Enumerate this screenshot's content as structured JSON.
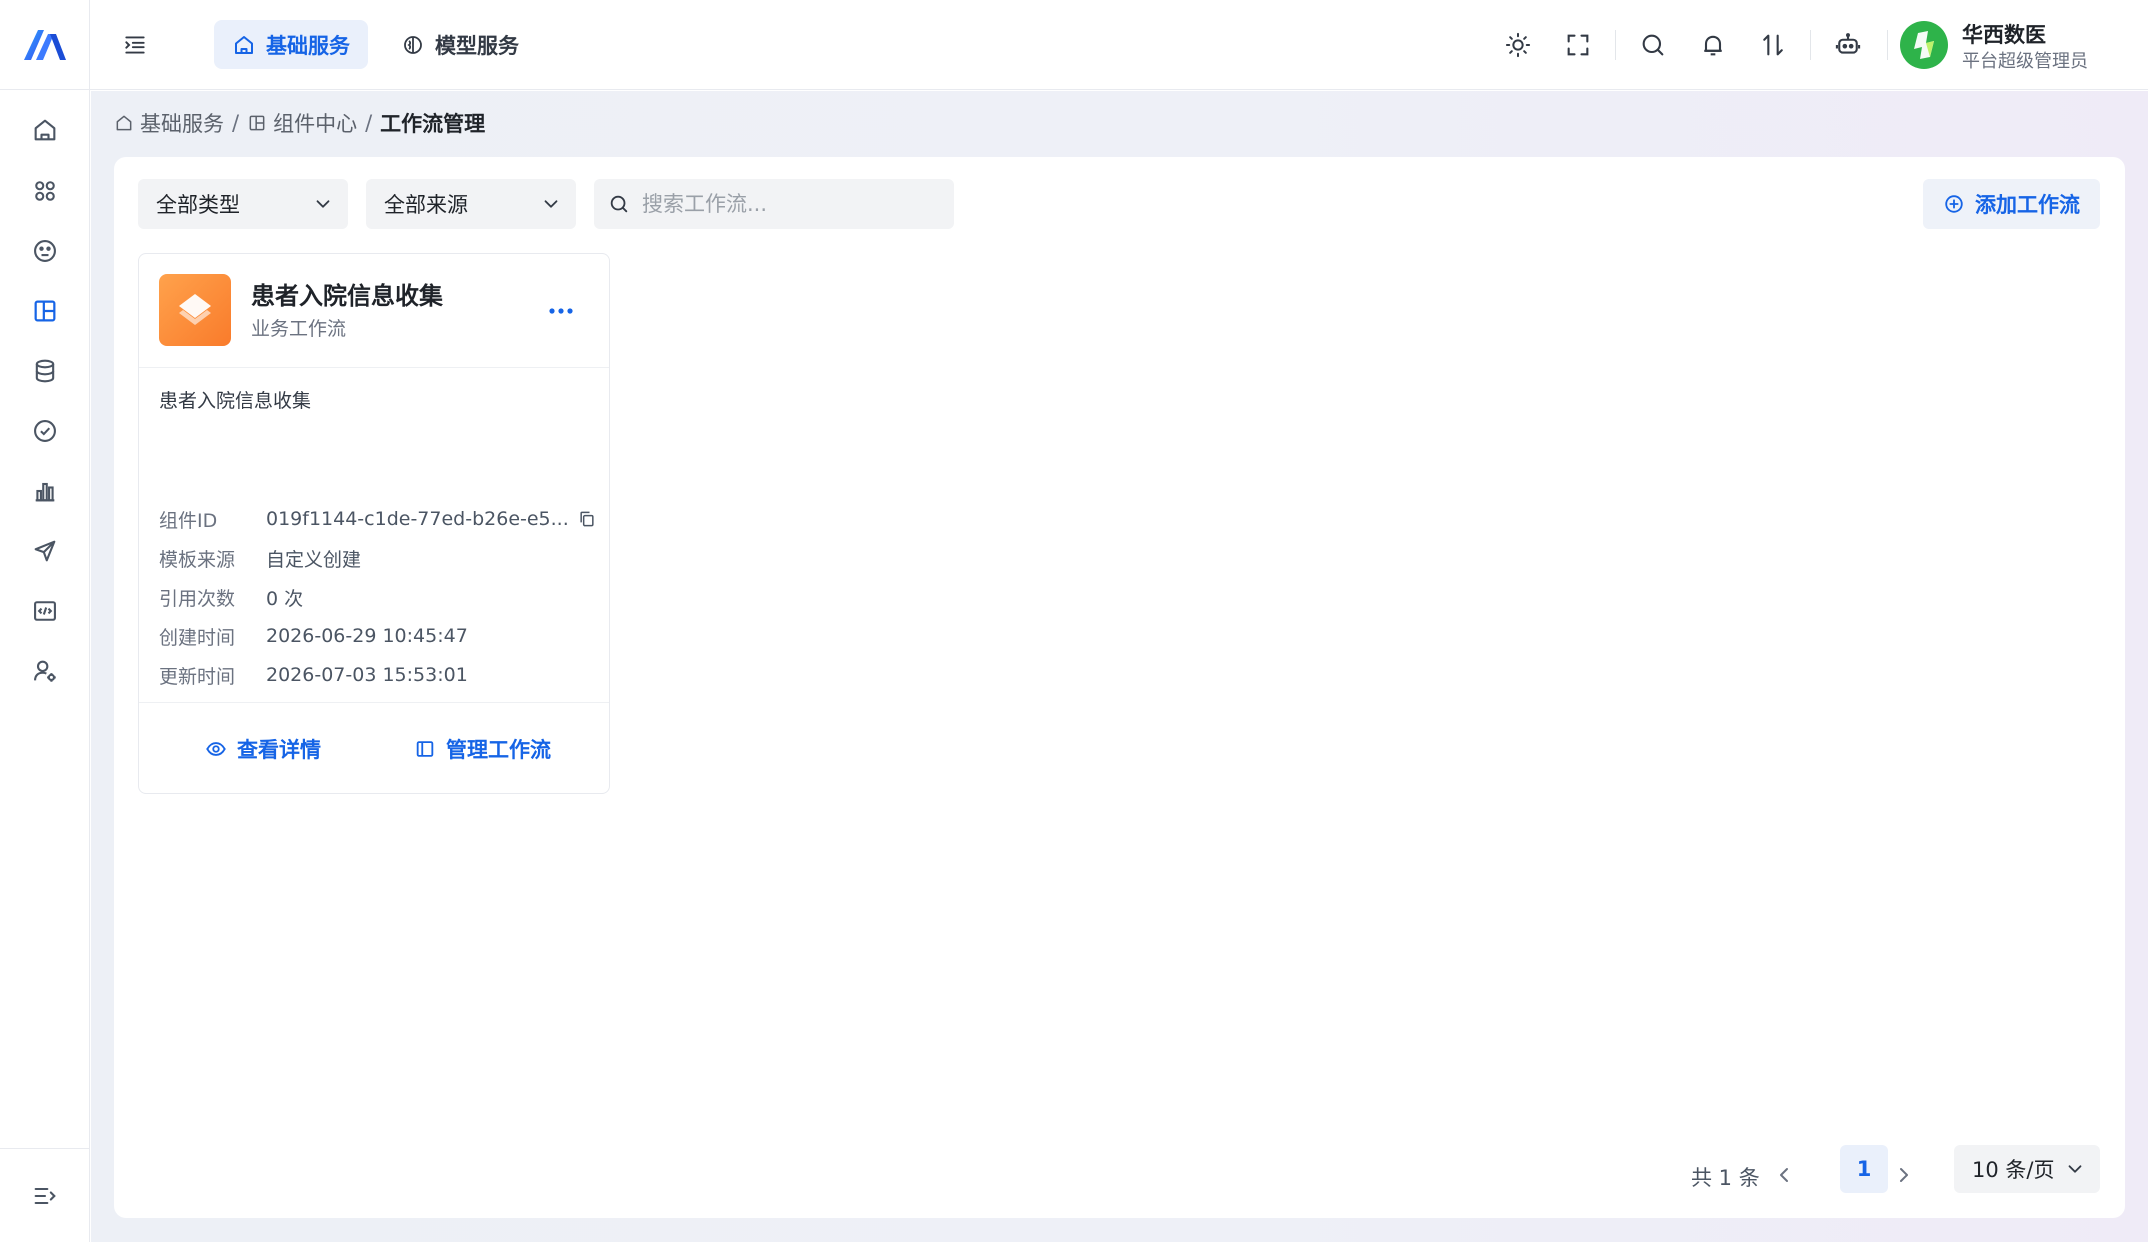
{
  "header": {
    "tabs": [
      {
        "label": "基础服务",
        "active": true
      },
      {
        "label": "模型服务",
        "active": false
      }
    ],
    "user": {
      "name": "华西数医",
      "role": "平台超级管理员"
    },
    "icons": [
      "sun-icon",
      "fullscreen-icon",
      "search-icon",
      "bell-icon",
      "swap-icon",
      "robot-icon"
    ]
  },
  "sidebar": {
    "items": [
      {
        "name": "home",
        "icon": "home-icon",
        "active": false
      },
      {
        "name": "apps",
        "icon": "apps-grid-icon",
        "active": false
      },
      {
        "name": "model",
        "icon": "gauge-icon",
        "active": false
      },
      {
        "name": "components",
        "icon": "layout-icon",
        "active": true
      },
      {
        "name": "data",
        "icon": "database-icon",
        "active": false
      },
      {
        "name": "review",
        "icon": "check-circle-icon",
        "active": false
      },
      {
        "name": "stats",
        "icon": "bar-chart-icon",
        "active": false
      },
      {
        "name": "publish",
        "icon": "send-icon",
        "active": false
      },
      {
        "name": "dev",
        "icon": "code-icon",
        "active": false
      },
      {
        "name": "users",
        "icon": "user-settings-icon",
        "active": false
      }
    ]
  },
  "breadcrumb": {
    "items": [
      "基础服务",
      "组件中心",
      "工作流管理"
    ],
    "separator": "/"
  },
  "filters": {
    "type_select": "全部类型",
    "source_select": "全部来源",
    "search_placeholder": "搜索工作流...",
    "add_button": "添加工作流"
  },
  "cards": [
    {
      "title": "患者入院信息收集",
      "subtitle": "业务工作流",
      "description": "患者入院信息收集",
      "meta": [
        {
          "label": "组件ID",
          "value": "019f1144-c1de-77ed-b26e-e5..."
        },
        {
          "label": "模板来源",
          "value": "自定义创建"
        },
        {
          "label": "引用次数",
          "value": "0 次"
        },
        {
          "label": "创建时间",
          "value": "2026-06-29 10:45:47"
        },
        {
          "label": "更新时间",
          "value": "2026-07-03 15:53:01"
        }
      ],
      "actions": {
        "view": "查看详情",
        "manage": "管理工作流"
      }
    }
  ],
  "pagination": {
    "total": "共 1 条",
    "current_page": "1",
    "page_size": "10 条/页"
  },
  "colors": {
    "accent": "#1664e6",
    "card_icon": "#f98a35",
    "avatar": "#2eb34a"
  }
}
